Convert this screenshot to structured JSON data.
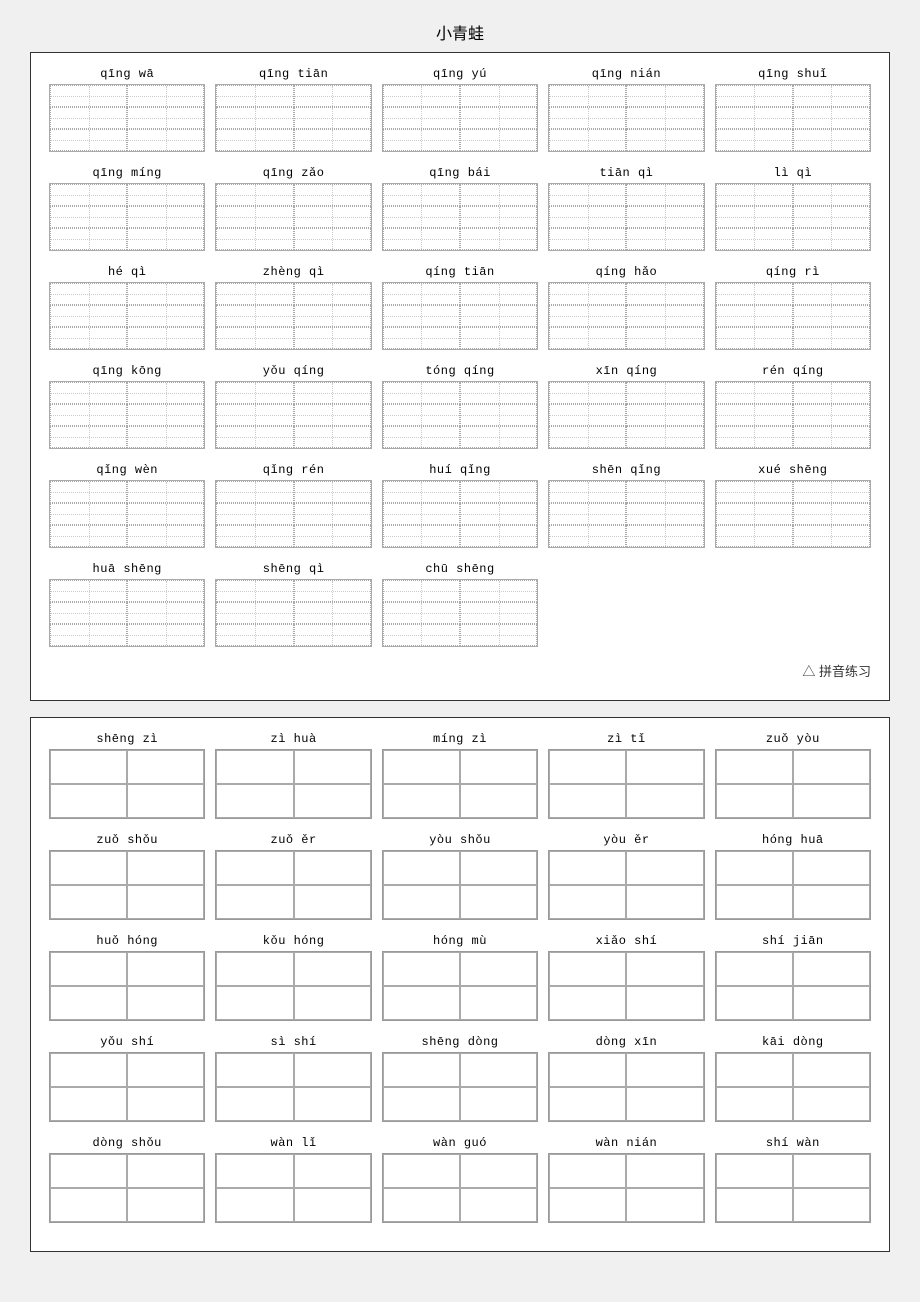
{
  "title": "小青蛙",
  "section1": {
    "subtitle": "△ 拼音练习",
    "rows": [
      [
        {
          "label": "qīng  wā"
        },
        {
          "label": "qīng  tiān"
        },
        {
          "label": "qīng  yú"
        },
        {
          "label": "qīng  nián"
        },
        {
          "label": "qīng  shuǐ"
        }
      ],
      [
        {
          "label": "qīng  míng"
        },
        {
          "label": "qīng  zǎo"
        },
        {
          "label": "qīng  bái"
        },
        {
          "label": "tiān  qì"
        },
        {
          "label": "lì  qì"
        }
      ],
      [
        {
          "label": "hé  qì"
        },
        {
          "label": "zhèng  qì"
        },
        {
          "label": "qíng  tiān"
        },
        {
          "label": "qíng  hǎo"
        },
        {
          "label": "qíng  rì"
        }
      ],
      [
        {
          "label": "qīng  kōng"
        },
        {
          "label": "yǒu  qíng"
        },
        {
          "label": "tóng  qíng"
        },
        {
          "label": "xīn  qíng"
        },
        {
          "label": "rén  qíng"
        }
      ],
      [
        {
          "label": "qǐng  wèn"
        },
        {
          "label": "qǐng  rén"
        },
        {
          "label": "huí  qǐng"
        },
        {
          "label": "shēn  qǐng"
        },
        {
          "label": "xué  shēng"
        }
      ],
      [
        {
          "label": "huā  shēng"
        },
        {
          "label": "shēng  qì"
        },
        {
          "label": "chū  shēng"
        },
        {
          "label": ""
        },
        {
          "label": ""
        }
      ]
    ]
  },
  "section2": {
    "rows": [
      [
        {
          "label": "shēng  zì"
        },
        {
          "label": "zì  huà"
        },
        {
          "label": "míng  zì"
        },
        {
          "label": "zì  tǐ"
        },
        {
          "label": "zuǒ  yòu"
        }
      ],
      [
        {
          "label": "zuǒ  shǒu"
        },
        {
          "label": "zuǒ  ěr"
        },
        {
          "label": "yòu  shǒu"
        },
        {
          "label": "yòu  ěr"
        },
        {
          "label": "hóng  huā"
        }
      ],
      [
        {
          "label": "huǒ  hóng"
        },
        {
          "label": "kǒu  hóng"
        },
        {
          "label": "hóng  mù"
        },
        {
          "label": "xiǎo  shí"
        },
        {
          "label": "shí  jiān"
        }
      ],
      [
        {
          "label": "yǒu  shí"
        },
        {
          "label": "sì  shí"
        },
        {
          "label": "shēng  dòng"
        },
        {
          "label": "dòng  xīn"
        },
        {
          "label": "kāi  dòng"
        }
      ],
      [
        {
          "label": "dòng  shǒu"
        },
        {
          "label": "wàn  lǐ"
        },
        {
          "label": "wàn  guó"
        },
        {
          "label": "wàn  nián"
        },
        {
          "label": "shí  wàn"
        }
      ]
    ]
  }
}
